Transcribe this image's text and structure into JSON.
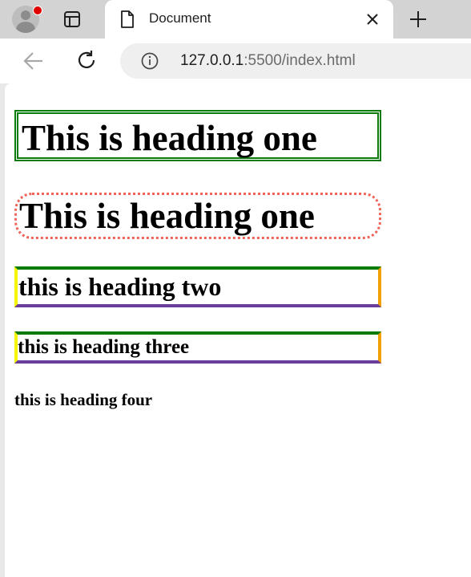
{
  "browser": {
    "tab": {
      "title": "Document"
    },
    "address_bar": {
      "host": "127.0.0.1",
      "rest": ":5500/index.html"
    },
    "icons": {
      "profile": "profile-avatar-icon",
      "tab_actions": "tab-actions-icon",
      "document": "document-icon",
      "close": "close-icon",
      "new_tab": "plus-icon",
      "back": "back-arrow-icon",
      "reload": "reload-icon",
      "info": "info-icon"
    },
    "colors": {
      "profile_badge": "#e00000"
    }
  },
  "page": {
    "heading1_double": "This is heading one",
    "heading1_dotted": "This is heading one",
    "heading2": "this is heading two",
    "heading3": "this is heading three",
    "heading4": "this is heading four",
    "colors": {
      "green": "#0a7a0a",
      "coral": "#f0655a",
      "yellow": "#f5f500",
      "orange": "#f0a000",
      "purple": "#6a3d9a"
    }
  }
}
